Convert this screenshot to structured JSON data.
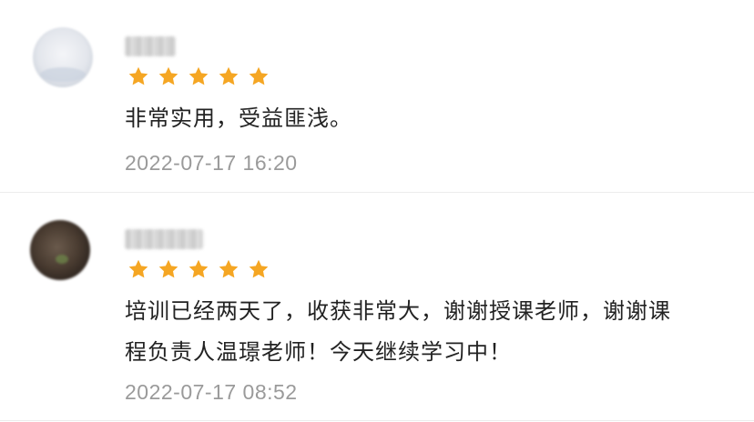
{
  "reviews": [
    {
      "username": "",
      "rating": 5,
      "comment": "非常实用，受益匪浅。",
      "timestamp": "2022-07-17 16:20"
    },
    {
      "username": "",
      "rating": 5,
      "comment": "培训已经两天了，收获非常大，谢谢授课老师，谢谢课\n程负责人温璟老师！今天继续学习中！",
      "timestamp": "2022-07-17 08:52"
    }
  ],
  "colors": {
    "star": "#f5a623",
    "timestamp": "#9a9a9a",
    "text": "#222222",
    "divider": "#ececec"
  },
  "icons": {
    "rating_star": "star-icon"
  }
}
